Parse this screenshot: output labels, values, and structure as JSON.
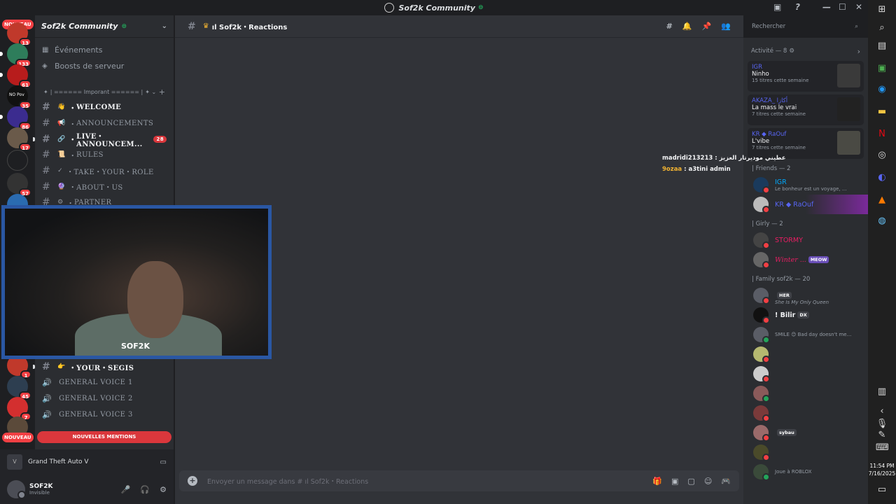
{
  "window": {
    "title": "Sof2k Community",
    "controls": [
      "—",
      "☐",
      "✕"
    ]
  },
  "servers": [
    {
      "badge": "13",
      "label": "NOUVEAU"
    },
    {
      "badge": "133"
    },
    {
      "badge": "61"
    },
    {
      "badge": "35",
      "label": "NO Pov"
    },
    {
      "badge": "86"
    },
    {
      "badge": "17"
    },
    {
      "badge": ""
    },
    {
      "badge": "57"
    },
    {
      "badge": ""
    },
    {
      "badge": "1"
    },
    {
      "badge": "45"
    },
    {
      "badge": "7"
    },
    {
      "badge": "",
      "label": "NOUVEAU"
    }
  ],
  "guild": {
    "name": "Sof2k Community",
    "nav": [
      {
        "icon": "calendar-icon",
        "label": "Événements"
      },
      {
        "icon": "boost-icon",
        "label": "Boosts de serveur"
      }
    ],
    "category": "| ====== Imporant ====== |",
    "channels": [
      {
        "emoji": "👋",
        "label": "WELCOME",
        "bright": true
      },
      {
        "emoji": "📢",
        "label": "ANNOUNCEMENTS",
        "bright": false
      },
      {
        "emoji": "🔗",
        "label": "LIVE・ANNOUNCEM...",
        "bright": true,
        "badge": "28"
      },
      {
        "emoji": "📜",
        "label": "RULES",
        "bright": false
      },
      {
        "emoji": "✓",
        "label": "TAKE・YOUR・ROLE",
        "bright": false
      },
      {
        "emoji": "🔮",
        "label": "ABOUT・US",
        "bright": false
      },
      {
        "emoji": "⚙",
        "label": "PARTNER",
        "bright": false
      },
      {
        "emoji": "👉",
        "label": "YOUR・SEGIS",
        "bright": true
      }
    ],
    "voice": [
      {
        "label": "GENERAL VOICE 1"
      },
      {
        "label": "GENERAL VOICE 2"
      },
      {
        "label": "GENERAL VOICE 3"
      }
    ],
    "mentions_pill": "NOUVELLES MENTIONS"
  },
  "activity": {
    "game": "Grand Theft Auto V"
  },
  "user": {
    "name": "SOF2K",
    "status": "Invisible"
  },
  "channel": {
    "title": "ıl Sof2k・Reactions",
    "composer_placeholder": "Envoyer un message dans # ıl Sof2k・Reactions"
  },
  "search": {
    "placeholder": "Rechercher"
  },
  "members_panel": {
    "activity_header": "Activité — 8",
    "activity_cards": [
      {
        "user": "IGR",
        "title": "Ninho",
        "sub": "15 titres cette semaine"
      },
      {
        "user": "AKAZA_ أكازا",
        "title": "La mass le vrai",
        "sub": "7 titres cette semaine"
      },
      {
        "user": "KR ◆ RaOuf",
        "title": "L'vibe",
        "sub": "7 titres cette semaine"
      }
    ],
    "groups": [
      {
        "name": "| Friends — 2",
        "members": [
          {
            "name": "IGR",
            "sub": "Le bonheur est un voyage, ...",
            "color": "#00a8fc",
            "online": false
          },
          {
            "name": "KR ◆ RaOuf",
            "sub": "",
            "color": "#5865f2",
            "online": false
          }
        ]
      },
      {
        "name": "| Girly — 2",
        "members": [
          {
            "name": "STORMY",
            "sub": "",
            "color": "#e91e63",
            "online": false
          },
          {
            "name": "Winter ...",
            "sub": "",
            "color": "#e91e63",
            "tag": "MEOW",
            "online": false
          }
        ]
      },
      {
        "name": "| Family sof2k — 20",
        "members": [
          {
            "name": "",
            "sub": "She Is My Only Queen",
            "color": "#5865f2",
            "tag": "HER",
            "online": false
          },
          {
            "name": "! Bilir",
            "sub": "",
            "color": "#f2f3f5",
            "tag": "DX",
            "online": false
          },
          {
            "name": "",
            "sub": "SMILE 😊 Bad day doesn't me...",
            "color": "#5865f2",
            "online": true
          },
          {
            "name": "",
            "sub": "",
            "color": "#5865f2",
            "online": false
          },
          {
            "name": "",
            "sub": "",
            "color": "#5865f2",
            "online": false
          },
          {
            "name": "",
            "sub": "",
            "color": "#5865f2",
            "online": true
          },
          {
            "name": "",
            "sub": "",
            "color": "#5865f2",
            "online": false
          },
          {
            "name": "",
            "sub": "",
            "color": "#5865f2",
            "tag": "sybau",
            "online": false
          },
          {
            "name": "",
            "sub": "",
            "color": "#5865f2",
            "online": false
          },
          {
            "name": "",
            "sub": "Joue à ROBLOX",
            "color": "#5865f2",
            "online": true
          }
        ]
      }
    ]
  },
  "stream_chat": [
    {
      "user": "madridi213213",
      "text": "عطيني موديرتار العزيز",
      "color": "#f2f3f5"
    },
    {
      "user": "9ozaa",
      "text": "a3tini admin",
      "color": "#f0b232"
    }
  ],
  "webcam": {
    "overlay_text": "SOF2K"
  },
  "taskbar": {
    "time": "11:54 PM",
    "date": "7/16/2025"
  }
}
